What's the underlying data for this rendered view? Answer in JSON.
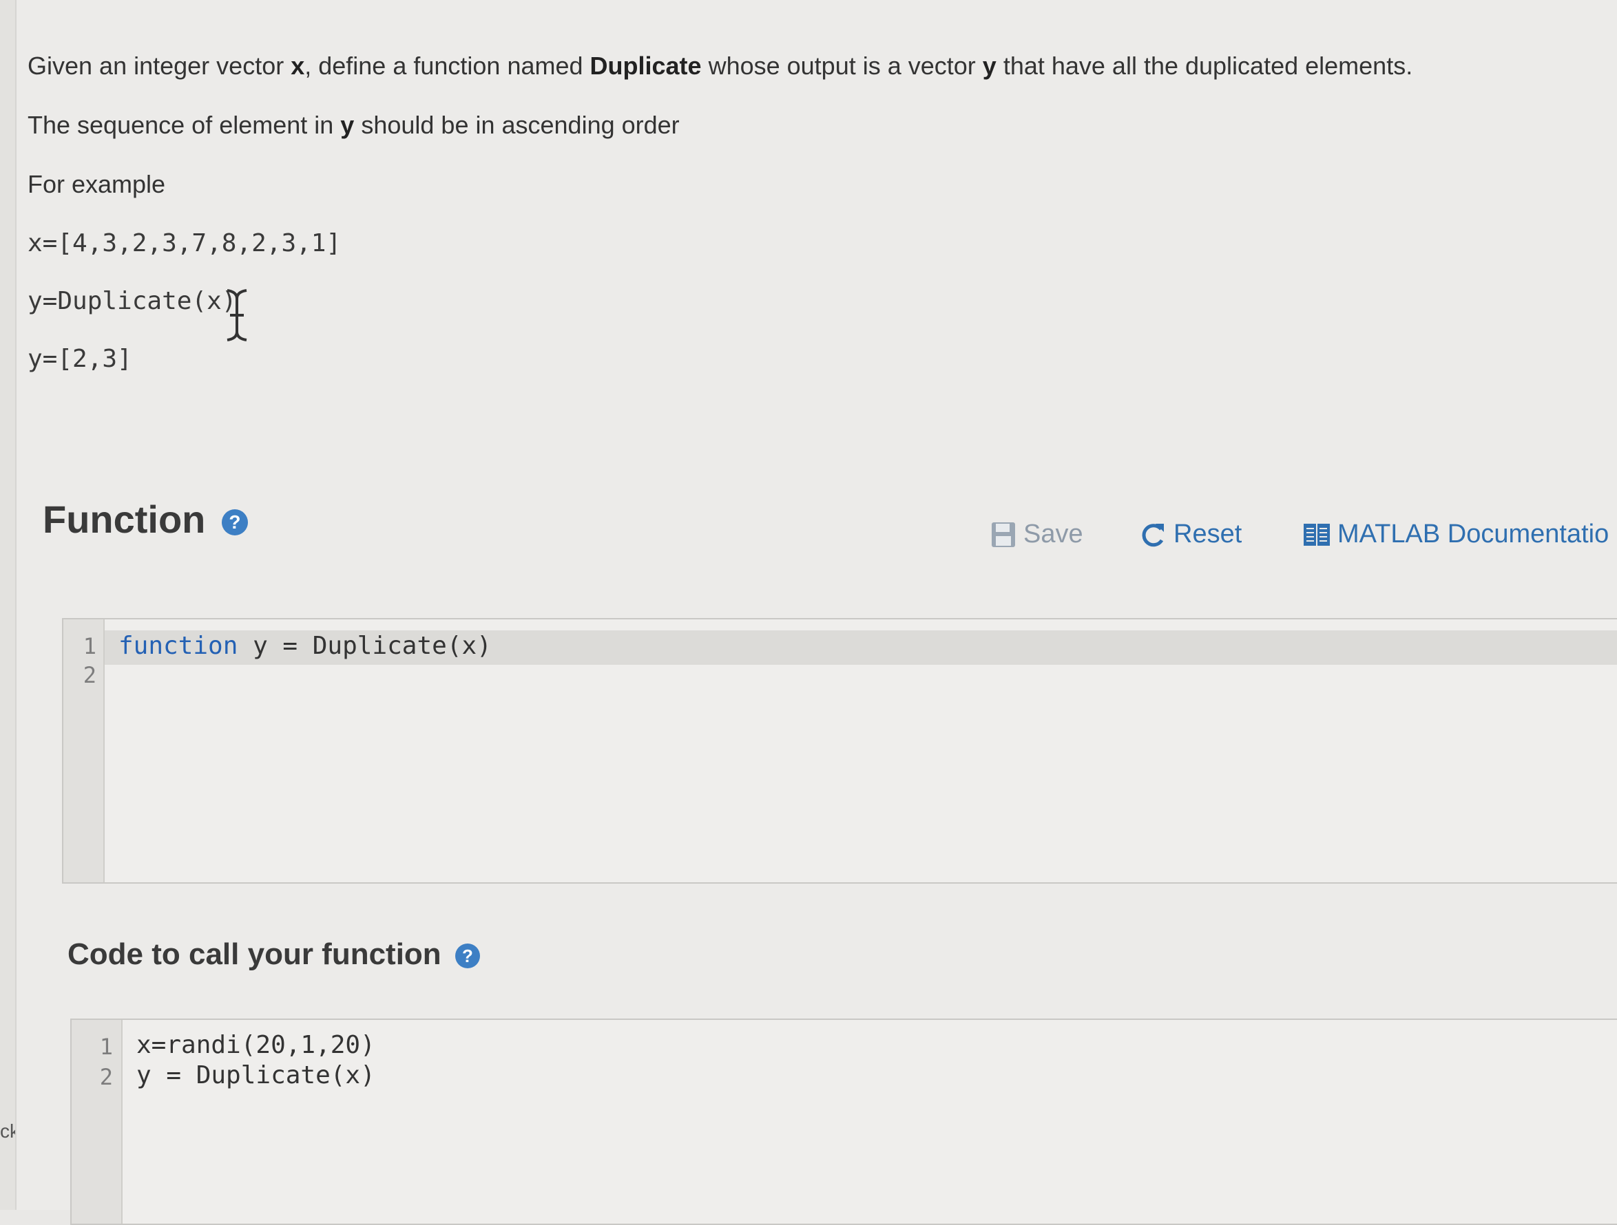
{
  "left_gutter": {
    "label": "ck"
  },
  "problem": {
    "line1": {
      "t1": "Given an integer vector ",
      "b1": "x",
      "t2": ", define a function named ",
      "b2": "Duplicate",
      "t3": " whose output is a vector ",
      "b3": "y",
      "t4": " that have all the duplicated elements."
    },
    "line2": {
      "t1": "The sequence of element in ",
      "b1": "y",
      "t2": " should be in ascending order"
    },
    "line3": "For example",
    "example": [
      "x=[4,3,2,3,7,8,2,3,1]",
      "y=Duplicate(x)",
      "y=[2,3]"
    ]
  },
  "function_section": {
    "title": "Function",
    "help": "?",
    "toolbar": {
      "save_label": "Save",
      "reset_label": "Reset",
      "docs_label": "MATLAB Documentatio"
    },
    "editor": {
      "lines": [
        {
          "num": "1",
          "keyword": "function",
          "rest": " y = Duplicate(x)"
        },
        {
          "num": "2",
          "keyword": "",
          "rest": ""
        }
      ]
    }
  },
  "call_section": {
    "title": "Code to call your function",
    "help": "?",
    "editor": {
      "lines": [
        {
          "num": "1",
          "code": "x=randi(20,1,20)"
        },
        {
          "num": "2",
          "code": "y = Duplicate(x)"
        }
      ]
    }
  },
  "colors": {
    "accent": "#2f6fb0",
    "keyword": "#2461b4",
    "help_icon": "#3d7fc4"
  },
  "icons": {
    "save": "floppy-disk-icon",
    "reset": "refresh-icon",
    "docs": "book-icon",
    "help": "question-circle-icon",
    "cursor": "text-cursor-icon"
  }
}
